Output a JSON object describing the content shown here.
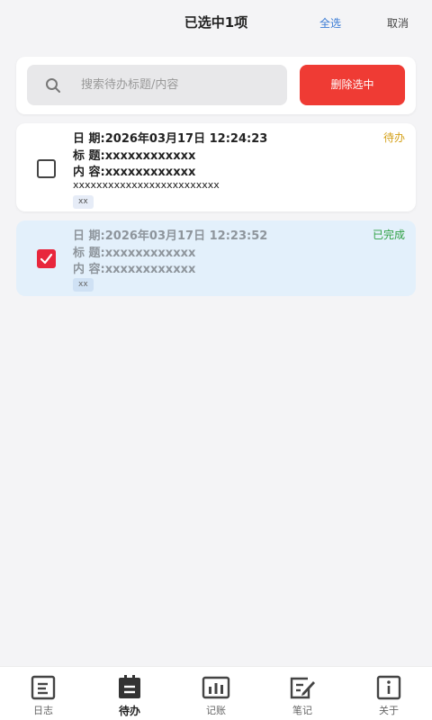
{
  "header": {
    "title": "已选中1项",
    "select_all": "全选",
    "cancel": "取消"
  },
  "search": {
    "placeholder": "搜索待办标题/内容",
    "value": ""
  },
  "toolbar": {
    "delete_label": "删除选中"
  },
  "items": [
    {
      "selected": false,
      "status": "待办",
      "date_line": "日 期:2026年03月17日 12:24:23",
      "title_line": "标 题:xxxxxxxxxxxx",
      "content_line": "内 容:xxxxxxxxxxxx",
      "content_extra": "xxxxxxxxxxxxxxxxxxxxxxxxx",
      "tag": "xx"
    },
    {
      "selected": true,
      "status": "已完成",
      "date_line": "日 期:2026年03月17日 12:23:52",
      "title_line": "标 题:xxxxxxxxxxxx",
      "content_line": "内 容:xxxxxxxxxxxx",
      "tag": "xx"
    }
  ],
  "nav": [
    {
      "label": "日志",
      "icon": "journal-icon",
      "active": false
    },
    {
      "label": "待办",
      "icon": "todo-icon",
      "active": true
    },
    {
      "label": "记账",
      "icon": "chart-icon",
      "active": false
    },
    {
      "label": "笔记",
      "icon": "note-edit-icon",
      "active": false
    },
    {
      "label": "关于",
      "icon": "info-icon",
      "active": false
    }
  ],
  "colors": {
    "accent": "#3a7bd5",
    "danger": "#ef3b34",
    "checked": "#e8263c",
    "pending": "#d4a017",
    "done": "#2ea043",
    "selected_bg": "#e3f0fb"
  }
}
